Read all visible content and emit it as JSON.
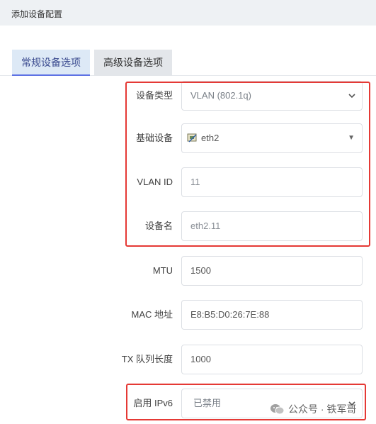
{
  "header": {
    "title": "添加设备配置"
  },
  "tabs": [
    {
      "label": "常规设备选项",
      "active": true
    },
    {
      "label": "高级设备选项",
      "active": false
    }
  ],
  "form": {
    "device_type": {
      "label": "设备类型",
      "value": "VLAN (802.1q)"
    },
    "base_device": {
      "label": "基础设备",
      "value": "eth2",
      "icon": "ethernet-port-icon"
    },
    "vlan_id": {
      "label": "VLAN ID",
      "value": "11"
    },
    "device_name": {
      "label": "设备名",
      "value": "eth2.11"
    },
    "mtu": {
      "label": "MTU",
      "value": "1500"
    },
    "mac": {
      "label": "MAC 地址",
      "value": "E8:B5:D0:26:7E:88"
    },
    "txqueue": {
      "label": "TX 队列长度",
      "value": "1000"
    },
    "ipv6": {
      "label": "启用 IPv6",
      "value": "已禁用"
    }
  },
  "watermark": {
    "text": "公众号 · 铁军哥"
  },
  "colors": {
    "highlight": "#e53935",
    "tab_active_bg": "#dde9f6",
    "tab_active_border": "#5e72e4"
  }
}
